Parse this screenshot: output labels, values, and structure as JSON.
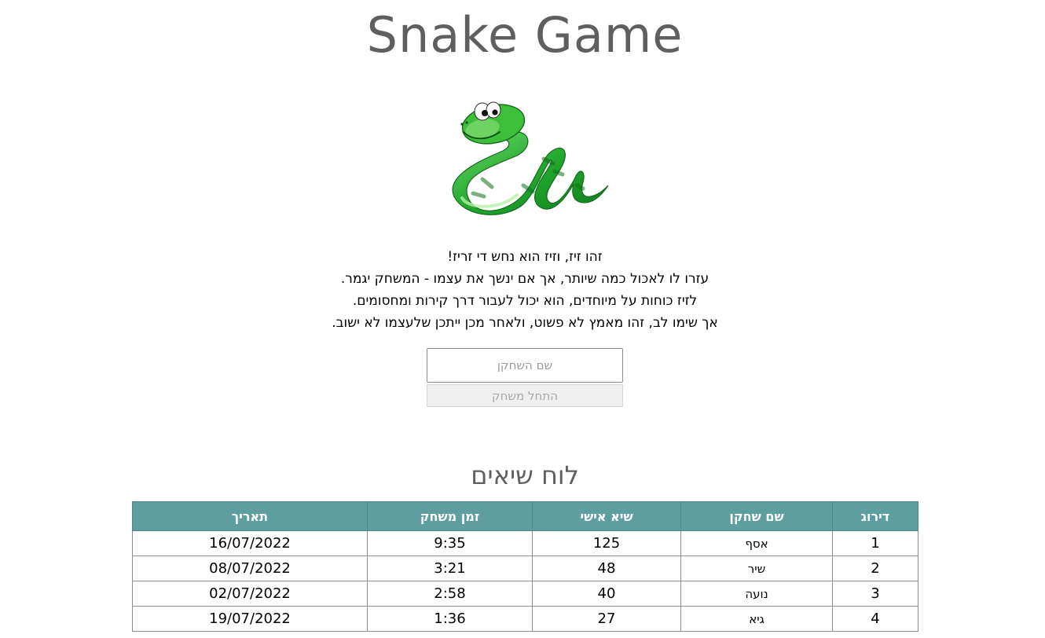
{
  "header": {
    "title": "Snake Game"
  },
  "hero": {
    "image": "cartoon-green-snake"
  },
  "intro": {
    "lines": [
      "זהו זיז, וזיז הוא נחש די זריז!",
      "עזרו לו לאכול כמה שיותר, אך אם ינשך את עצמו - המשחק יגמר.",
      "לזיז כוחות על מיוחדים, הוא יכול לעבור דרך קירות ומחסומים.",
      "אך שימו לב, זהו מאמץ לא פשוט, ולאחר מכן ייתכן שלעצמו לא ישוב."
    ]
  },
  "form": {
    "name_placeholder": "שם השחקן",
    "name_value": "",
    "start_label": "התחל משחק"
  },
  "leaderboard": {
    "title": "לוח שיאים",
    "columns": [
      "דירוג",
      "שם שחקן",
      "שיא אישי",
      "זמן משחק",
      "תאריך"
    ],
    "rows": [
      {
        "rank": "1",
        "name": "אסף",
        "score": "125",
        "time": "9:35",
        "date": "16/07/2022"
      },
      {
        "rank": "2",
        "name": "שיר",
        "score": "48",
        "time": "3:21",
        "date": "08/07/2022"
      },
      {
        "rank": "3",
        "name": "נועה",
        "score": "40",
        "time": "2:58",
        "date": "02/07/2022"
      },
      {
        "rank": "4",
        "name": "גיא",
        "score": "27",
        "time": "1:36",
        "date": "19/07/2022"
      }
    ]
  },
  "colors": {
    "header_text": "#5f5f5f",
    "table_header_bg": "#5f9ea0",
    "snake_green": "#2fae3a"
  }
}
